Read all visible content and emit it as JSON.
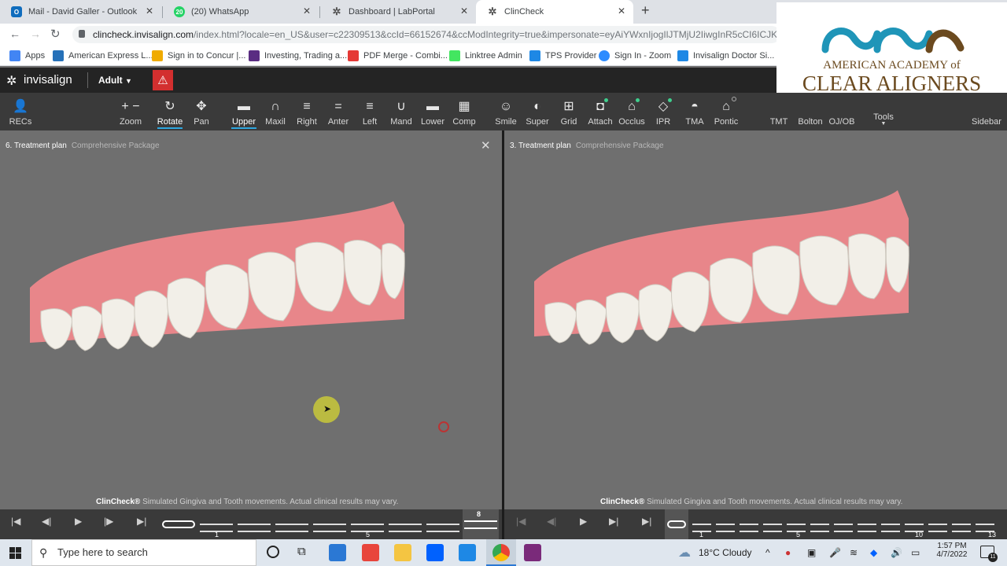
{
  "browser": {
    "tabs": [
      {
        "label": "Mail - David Galler - Outlook",
        "icon": "outlook-icon",
        "color": "#0f6cbd"
      },
      {
        "label": "(20) WhatsApp",
        "icon": "whatsapp-icon",
        "color": "#25d366",
        "badge": "20"
      },
      {
        "label": "Dashboard | LabPortal",
        "icon": "labportal-icon",
        "color": "#555555"
      },
      {
        "label": "ClinCheck",
        "icon": "clincheck-icon",
        "color": "#555555"
      }
    ],
    "url_host": "clincheck.invisalign.com",
    "url_rest": "/index.html?locale=en_US&user=c22309513&ccId=66152674&ccModIntegrity=true&impersonate=eyAiYWxnIjogIlJTMjU2IiwgInR5cCI6ICJKV1QiL",
    "bookmarks": [
      {
        "label": "Apps",
        "color": "#4285f4"
      },
      {
        "label": "American Express L...",
        "color": "#2671b9"
      },
      {
        "label": "Sign in to Concur |...",
        "color": "#f0ab00"
      },
      {
        "label": "Investing, Trading a...",
        "color": "#5a2d82"
      },
      {
        "label": "PDF Merge - Combi...",
        "color": "#e53935"
      },
      {
        "label": "Linktree Admin",
        "color": "#43e660"
      },
      {
        "label": "TPS Provider",
        "color": "#1e88e5"
      },
      {
        "label": "Sign In - Zoom",
        "color": "#2d8cff"
      },
      {
        "label": "Invisalign Doctor Si...",
        "color": "#1e88e5"
      }
    ]
  },
  "logo": {
    "line1": "AMERICAN ACADEMY of",
    "line2": "CLEAR ALIGNERS"
  },
  "app": {
    "brand": "invisalign",
    "patient_type": "Adult",
    "tools": [
      {
        "label": "RECs",
        "icon": "person-icon",
        "glyph": "👤"
      },
      {
        "label": "Zoom",
        "icon": "zoom-icon",
        "glyph": "+ −"
      },
      {
        "label": "Rotate",
        "icon": "rotate-icon",
        "glyph": "↻",
        "selected": true
      },
      {
        "label": "Pan",
        "icon": "pan-icon",
        "glyph": "✥"
      },
      {
        "label": "Upper",
        "icon": "upper-jaw-icon",
        "glyph": "▬",
        "selected": true
      },
      {
        "label": "Maxil",
        "icon": "maxillary-icon",
        "glyph": "∩"
      },
      {
        "label": "Right",
        "icon": "right-view-icon",
        "glyph": "≡"
      },
      {
        "label": "Anter",
        "icon": "anterior-view-icon",
        "glyph": "="
      },
      {
        "label": "Left",
        "icon": "left-view-icon",
        "glyph": "≡"
      },
      {
        "label": "Mand",
        "icon": "mandibular-icon",
        "glyph": "∪"
      },
      {
        "label": "Lower",
        "icon": "lower-jaw-icon",
        "glyph": "▬"
      },
      {
        "label": "Comp",
        "icon": "compare-icon",
        "glyph": "▦"
      },
      {
        "label": "Smile",
        "icon": "smile-icon",
        "glyph": "☺"
      },
      {
        "label": "Super",
        "icon": "superimpose-icon",
        "glyph": "◐"
      },
      {
        "label": "Grid",
        "icon": "grid-icon",
        "glyph": "⊞"
      },
      {
        "label": "Attach",
        "icon": "attachment-icon",
        "glyph": "◘"
      },
      {
        "label": "Occlus",
        "icon": "occlusion-icon",
        "glyph": "⌂"
      },
      {
        "label": "IPR",
        "icon": "ipr-icon",
        "glyph": "◇"
      },
      {
        "label": "TMA",
        "icon": "tma-icon",
        "glyph": "◓"
      },
      {
        "label": "Pontic",
        "icon": "pontic-icon",
        "glyph": "⌂"
      },
      {
        "label": "TMT",
        "icon": "tmt-icon",
        "glyph": ""
      },
      {
        "label": "Bolton",
        "icon": "bolton-icon",
        "glyph": ""
      },
      {
        "label": "OJ/OB",
        "icon": "ojob-icon",
        "glyph": ""
      },
      {
        "label": "Tools",
        "icon": "tools-icon",
        "glyph": ""
      },
      {
        "label": "Sidebar",
        "icon": "sidebar-icon",
        "glyph": ""
      }
    ],
    "panes": [
      {
        "title": "6. Treatment plan",
        "package": "Comprehensive Package"
      },
      {
        "title": "3. Treatment plan",
        "package": "Comprehensive Package"
      }
    ],
    "disclaimer_brand": "ClinCheck®",
    "disclaimer_text": "Simulated Gingiva and Tooth movements. Actual clinical results may vary.",
    "timeline_left": {
      "current": "8",
      "marks": [
        "1",
        "5"
      ]
    },
    "timeline_right": {
      "marks": [
        "1",
        "5",
        "10",
        "13"
      ]
    }
  },
  "taskbar": {
    "search_placeholder": "Type here to search",
    "weather": "18°C  Cloudy",
    "time": "1:57 PM",
    "date": "4/7/2022",
    "notif_count": "11"
  },
  "colors": {
    "accent": "#2ea7e0",
    "warning": "#d32f2f",
    "gum": "#e8868a",
    "logo_teal": "#1f95b8",
    "logo_brown": "#6b4a1f"
  }
}
